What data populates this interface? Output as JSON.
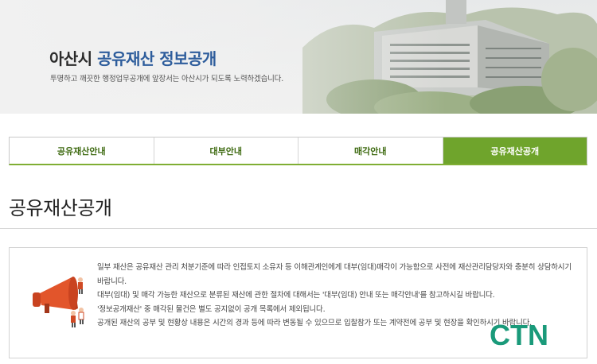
{
  "banner": {
    "title_prefix": "아산시",
    "title_accent": "공유재산 정보공개",
    "subtitle": "투명하고 깨끗한 행정업무공개에 앞장서는 아산시가 되도록 노력하겠습니다."
  },
  "tabs": [
    {
      "label": "공유재산안내",
      "active": false
    },
    {
      "label": "대부안내",
      "active": false
    },
    {
      "label": "매각안내",
      "active": false
    },
    {
      "label": "공유재산공개",
      "active": true
    }
  ],
  "page_title": "공유재산공개",
  "notice": {
    "paragraphs": [
      "일부 재산은 공유재산 관리 처분기준에 따라 인접토지 소유자 등 이해관계인에게 대부(임대)매각이 가능함으로 사전에 재산관리담당자와 충분히 상담하시기 바랍니다.",
      "대부(임대) 및 매각 가능한 재산으로 분류된 재산에 관한 절차에 대해서는 '대부(임대) 안내 또는 매각안내'를 참고하시길 바랍니다.",
      "'정보공개재산' 중 매각된 물건은 별도 공지없이 공개 목록에서 제외됩니다.",
      "공개된 재산의 공부 및 현황상 내용은 시간의 경과 등에 따라 변동될 수 있으므로 입찰참가 또는 계약전에 공부 및 현장을 확인하시기 바랍니다."
    ]
  },
  "watermark": {
    "text": "CTN"
  },
  "colors": {
    "active_tab": "#6fa42c",
    "tab_text": "#3f6b12",
    "accent_title": "#2e5d9c",
    "watermark": "#1a9a7a",
    "megaphone": "#e2552b"
  }
}
